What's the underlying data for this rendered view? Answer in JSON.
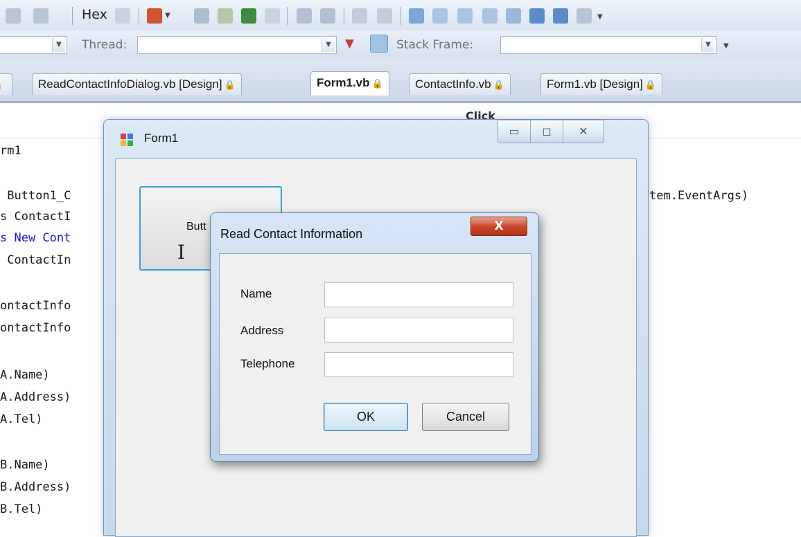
{
  "toolbar": {
    "hex_label": "Hex"
  },
  "debug_toolbar": {
    "thread_label": "Thread:",
    "stack_frame_label": "Stack Frame:"
  },
  "tabs": [
    {
      "label": "ReadContactInfoDialog.vb [Design]"
    },
    {
      "label": "Form1.vb"
    },
    {
      "label": "ContactInfo.vb"
    },
    {
      "label": "Form1.vb [Design]"
    }
  ],
  "nav": {
    "method_label": "Click"
  },
  "code_lines": [
    "rm1",
    " Button1_C",
    "s ContactI",
    "s New Cont",
    " ContactIn",
    "ontactInfo",
    "ontactInfo",
    "A.Name)",
    "A.Address)",
    "A.Tel)",
    "B.Name)",
    "B.Address)",
    "B.Tel)",
    "tem.EventArgs) "
  ],
  "form1": {
    "title": "Form1",
    "button_label": "Butt"
  },
  "dialog": {
    "title": "Read Contact Information",
    "close_glyph": "X",
    "fields": [
      {
        "label": "Name",
        "value": ""
      },
      {
        "label": "Address",
        "value": ""
      },
      {
        "label": "Telephone",
        "value": ""
      }
    ],
    "ok_label": "OK",
    "cancel_label": "Cancel"
  },
  "colors": {
    "accent_border": "#3c9fd6",
    "close_button": "#c8452a",
    "keyword_blue": "#1a1acc"
  }
}
